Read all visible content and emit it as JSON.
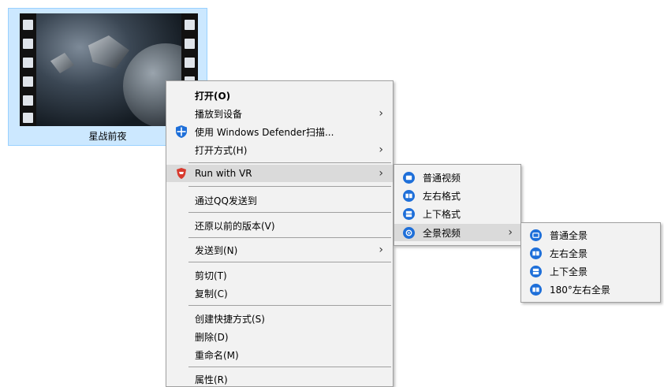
{
  "file": {
    "name": "星战前夜",
    "thumbnail_icon": "video-film-thumbnail"
  },
  "context_menu": {
    "items": [
      {
        "label": "打开(O)",
        "bold": true
      },
      {
        "label": "播放到设备",
        "submenu": true
      },
      {
        "label": "使用 Windows Defender扫描...",
        "icon": "windows-defender-icon"
      },
      {
        "label": "打开方式(H)",
        "submenu": true
      },
      {
        "label": "Run with VR",
        "icon": "vr-shield-icon",
        "submenu": true
      },
      {
        "label": "通过QQ发送到"
      },
      {
        "label": "还原以前的版本(V)"
      },
      {
        "label": "发送到(N)",
        "submenu": true
      },
      {
        "label": "剪切(T)"
      },
      {
        "label": "复制(C)"
      },
      {
        "label": "创建快捷方式(S)"
      },
      {
        "label": "删除(D)"
      },
      {
        "label": "重命名(M)"
      },
      {
        "label": "属性(R)"
      }
    ],
    "arrow_glyph": "›"
  },
  "vr_submenu": {
    "items": [
      {
        "label": "普通视频"
      },
      {
        "label": "左右格式"
      },
      {
        "label": "上下格式"
      },
      {
        "label": "全景视频",
        "submenu": true
      }
    ]
  },
  "panorama_submenu": {
    "items": [
      {
        "label": "普通全景"
      },
      {
        "label": "左右全景"
      },
      {
        "label": "上下全景"
      },
      {
        "label": "180°左右全景"
      }
    ]
  },
  "colors": {
    "selection_bg": "#cce8ff",
    "menu_bg": "#f2f2f2",
    "hover_bg": "#dadada",
    "icon_blue": "#1e6fd9",
    "vr_red": "#d83a2e"
  }
}
